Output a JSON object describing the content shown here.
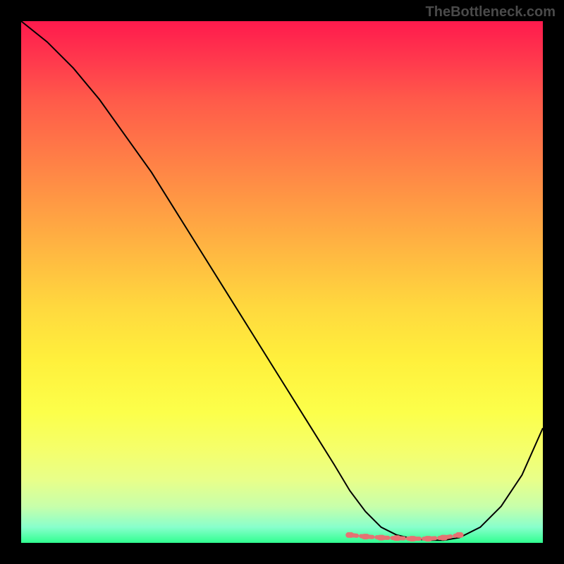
{
  "watermark": "TheBottleneck.com",
  "chart_data": {
    "type": "line",
    "title": "",
    "xlabel": "",
    "ylabel": "",
    "xlim": [
      0,
      100
    ],
    "ylim": [
      0,
      100
    ],
    "grid": false,
    "series": [
      {
        "name": "curve",
        "x": [
          0,
          5,
          10,
          15,
          20,
          25,
          30,
          35,
          40,
          45,
          50,
          55,
          60,
          63,
          66,
          69,
          72,
          75,
          78,
          81,
          84,
          88,
          92,
          96,
          100
        ],
        "values": [
          100,
          96,
          91,
          85,
          78,
          71,
          63,
          55,
          47,
          39,
          31,
          23,
          15,
          10,
          6,
          3,
          1.5,
          0.8,
          0.5,
          0.5,
          1,
          3,
          7,
          13,
          22
        ]
      }
    ],
    "markers": {
      "name": "dotted-segment",
      "color": "#e57373",
      "x": [
        63,
        66,
        69,
        72,
        75,
        78,
        81,
        84
      ],
      "values": [
        1.5,
        1.2,
        1.0,
        0.9,
        0.8,
        0.8,
        1.0,
        1.5
      ]
    },
    "background_gradient": {
      "top_color": "#ff1a4d",
      "mid_color": "#ffd93e",
      "bottom_color": "#30ff90"
    }
  }
}
